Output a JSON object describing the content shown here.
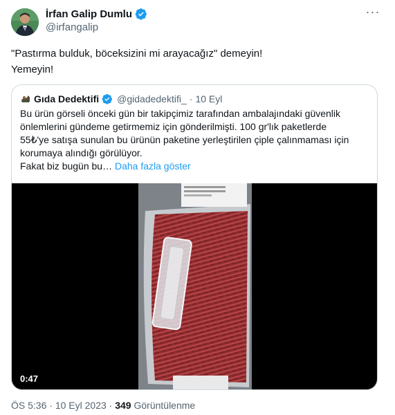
{
  "author": {
    "display_name": "İrfan Galip Dumlu",
    "handle": "@irfangalip",
    "verified_icon": "verified-badge-icon",
    "avatar_icon": "profile-avatar"
  },
  "menu": {
    "more_label": "···"
  },
  "tweet": {
    "line1": "\"Pastırma bulduk, böceksizini mi arayacağız\" demeyin!",
    "line2": "Yemeyin!"
  },
  "quoted": {
    "display_name": "Gıda Dedektifi",
    "handle": "@gidadedektifi_",
    "separator": "·",
    "date": "10 Eyl",
    "text_lines": [
      "Bu ürün görseli önceki gün bir takipçimiz tarafından ambalajındaki güvenlik",
      "önlemlerini gündeme getirmemiz için gönderilmişti. 100 gr'lık paketlerde",
      "55₺'ye satışa sunulan bu ürünün paketine yerleştirilen çiple çalınmaması için",
      "korumaya alındığı görülüyor.",
      "Fakat biz bugün bu…"
    ],
    "show_more": "Daha fazla göster",
    "video": {
      "duration": "0:47"
    }
  },
  "footer": {
    "time": "ÖS 5:36",
    "dot1": "·",
    "date": "10 Eyl 2023",
    "dot2": "·",
    "views_count": "349",
    "views_label": "Görüntülenme"
  },
  "colors": {
    "accent": "#1d9bf0",
    "text": "#0f1419",
    "muted": "#536471",
    "border": "#cfd9de",
    "verified": "#1d9bf0"
  }
}
